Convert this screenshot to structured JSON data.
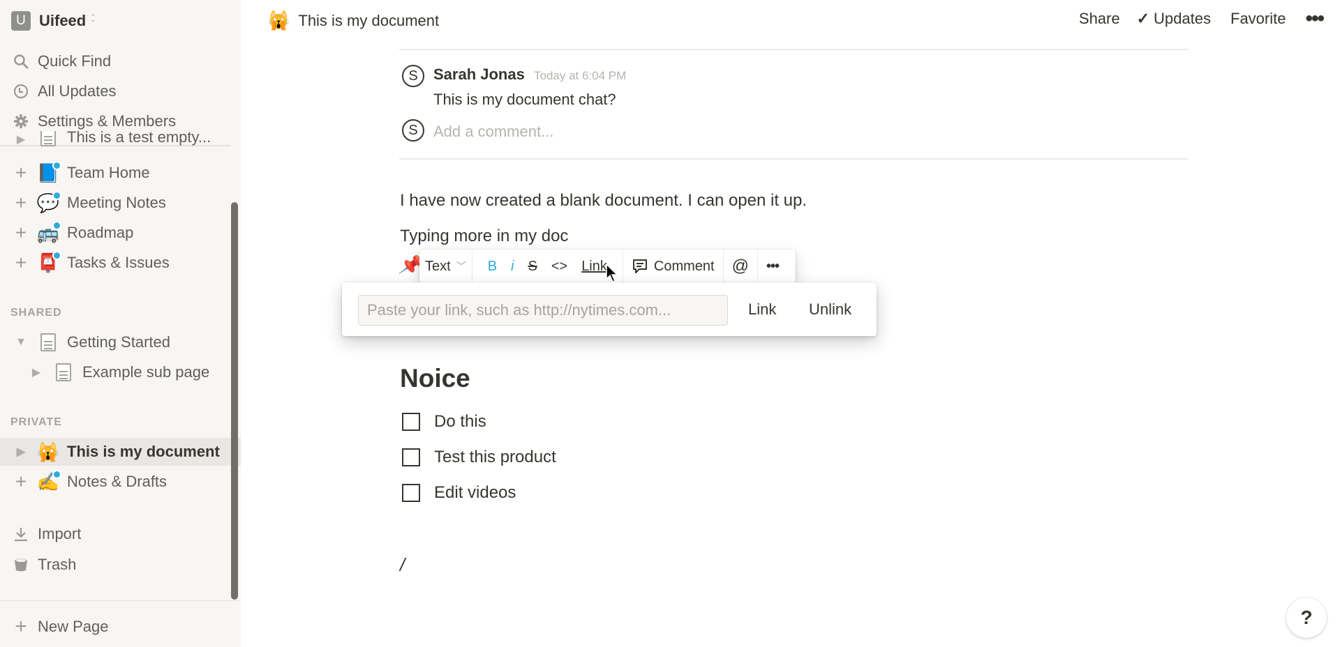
{
  "sidebar": {
    "workspace": {
      "initial": "U",
      "name": "Uifeed"
    },
    "nav": [
      {
        "label": "Quick Find",
        "icon": "search-icon"
      },
      {
        "label": "All Updates",
        "icon": "clock-icon"
      },
      {
        "label": "Settings & Members",
        "icon": "gear-icon"
      }
    ],
    "clipped_item": "This is a test empty...",
    "workspace_pages": [
      {
        "label": "Team Home",
        "emoji": "📘"
      },
      {
        "label": "Meeting Notes",
        "emoji": "💬"
      },
      {
        "label": "Roadmap",
        "emoji": "🚌"
      },
      {
        "label": "Tasks & Issues",
        "emoji": "📮"
      }
    ],
    "shared": {
      "heading": "SHARED",
      "pages": [
        {
          "label": "Getting Started",
          "expanded": true
        },
        {
          "label": "Example sub page",
          "expanded": false
        }
      ]
    },
    "private": {
      "heading": "PRIVATE",
      "pages": [
        {
          "label": "This is my document",
          "emoji": "🙀",
          "active": true
        },
        {
          "label": "Notes & Drafts",
          "emoji": "✍️"
        }
      ]
    },
    "bottom": [
      {
        "label": "Import",
        "icon": "download-icon"
      },
      {
        "label": "Trash",
        "icon": "trash-icon"
      }
    ],
    "new_page": "New Page"
  },
  "header": {
    "emoji": "🙀",
    "title": "This is my document",
    "share": "Share",
    "updates": "Updates",
    "favorite": "Favorite",
    "more": "•••"
  },
  "comment": {
    "avatar": "S",
    "author": "Sarah Jonas",
    "time": "Today at 6:04 PM",
    "text": "This is my document chat?",
    "placeholder": "Add a comment..."
  },
  "content": {
    "para1": "I have now created a blank document. I can open it up.",
    "para2": "Typing more in my doc",
    "heading": "Noice",
    "todos": [
      {
        "label": "Do this",
        "checked": false
      },
      {
        "label": "Test this product",
        "checked": false
      },
      {
        "label": "Edit videos",
        "checked": false
      }
    ],
    "slash": "/"
  },
  "toolbar": {
    "block_type": "Text",
    "bold": "B",
    "italic": "i",
    "strike": "S",
    "code": "<>",
    "link": "Link",
    "comment": "Comment",
    "mention": "@",
    "more": "•••",
    "accent": "#2eaadc"
  },
  "link_popup": {
    "input_value": "",
    "placeholder": "Paste your link, such as http://nytimes.com...",
    "link_button": "Link",
    "unlink_button": "Unlink"
  },
  "help": {
    "label": "?"
  }
}
